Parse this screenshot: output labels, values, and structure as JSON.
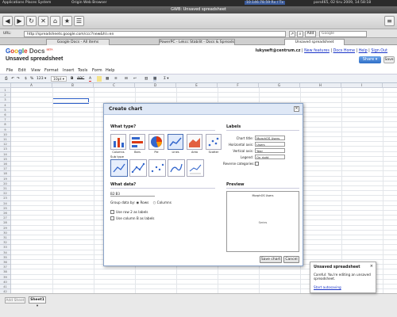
{
  "system_bar": {
    "app_menu": "Applications Places System",
    "browser_name": "Origin Web Browser",
    "network": "10.146.78.59 Rx / Tx",
    "clock": "pars465, 02 tiru 2009, 14:58:18"
  },
  "window": {
    "title": "GWB: Unsaved spreadsheet"
  },
  "address": {
    "label": "URL:",
    "url": "http://spreadsheets.google.com/ccc?new&hl=en",
    "add_label": "Add",
    "search_placeholder": "Google"
  },
  "tabs": [
    {
      "label": "Google Docs - All items"
    },
    {
      "label": "PowerPC - Lekcc Stabilit - Docs & Spreadsheets"
    },
    {
      "label": "Unsaved spreadsheet"
    }
  ],
  "header": {
    "logo": "Google Docs",
    "logo_sub": "BETA",
    "doc_title": "Unsaved spreadsheet",
    "user": "lukyseft@centrum.cz",
    "links": [
      "New features",
      "Docs Home",
      "Help",
      "Sign Out"
    ],
    "share_label": "Share ▾",
    "save_label": "Save"
  },
  "menu": [
    "File",
    "Edit",
    "View",
    "Format",
    "Insert",
    "Tools",
    "Form",
    "Help"
  ],
  "format_toolbar": {
    "number_format": "123 ▾",
    "font_size": "10pt ▾",
    "bold": "B",
    "strike": "ABC",
    "text_color": "A",
    "sum": "Σ ▾"
  },
  "grid": {
    "columns": [
      "A",
      "B",
      "C",
      "D",
      "E",
      "F",
      "G",
      "H",
      "I"
    ],
    "rows": [
      "1",
      "2",
      "3",
      "4",
      "5",
      "6",
      "7",
      "8",
      "9",
      "10",
      "11",
      "12",
      "13",
      "14",
      "15",
      "16",
      "17",
      "18",
      "19",
      "20",
      "21",
      "22",
      "23",
      "24",
      "25",
      "26",
      "27",
      "28",
      "29",
      "30",
      "31",
      "32",
      "33",
      "34",
      "35",
      "36",
      "37",
      "38",
      "39",
      "40",
      "41",
      "42"
    ]
  },
  "sheet_tabs": {
    "add_label": "Add Sheet",
    "sheet_label": "Sheet1 ▾"
  },
  "dialog": {
    "title": "Create chart",
    "what_type": "What type?",
    "chart_types": [
      "Columns",
      "Bars",
      "Pie",
      "Lines",
      "Area",
      "Scatter"
    ],
    "sub_type_label": "Sub type",
    "what_data": "What data?",
    "data_range": "B2:B3",
    "group_label": "Group data by:",
    "rows_label": "Rows",
    "columns_label": "Columns",
    "use_row_label": "Use row 2 as labels",
    "use_col_label": "Use column B as labels",
    "labels_header": "Labels",
    "chart_title_label": "Chart title:",
    "chart_title_value": "MorphOS Users",
    "h_axis_label": "Horizontal axis:",
    "h_axis_value": "Users",
    "v_axis_label": "Vertical axis:",
    "v_axis_value": "Year",
    "legend_label": "Legend:",
    "legend_value": "On right",
    "reverse_label": "Reverse categories:",
    "preview_header": "Preview",
    "preview_title": "MorphOS Users",
    "preview_body": "Series",
    "save_chart": "Save chart",
    "cancel": "Cancel"
  },
  "notification": {
    "title": "Unsaved spreadsheet",
    "body": "Careful: You're editing an unsaved spreadsheet.",
    "link": "Start autosaving",
    "close": "×"
  }
}
